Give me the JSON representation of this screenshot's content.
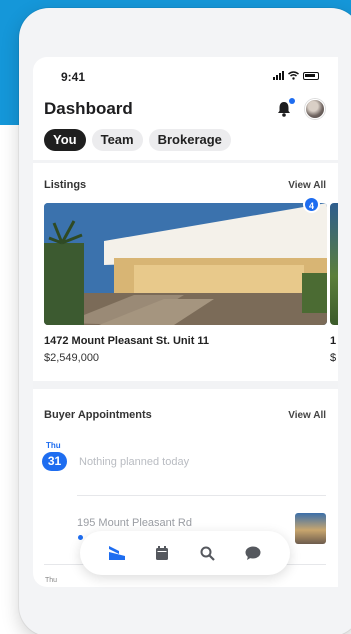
{
  "status_bar": {
    "time": "9:41"
  },
  "header": {
    "title": "Dashboard"
  },
  "tabs": [
    {
      "label": "You",
      "active": true
    },
    {
      "label": "Team",
      "active": false
    },
    {
      "label": "Brokerage",
      "active": false
    }
  ],
  "listings": {
    "title": "Listings",
    "view_all": "View All",
    "photo_badge": "4",
    "items": [
      {
        "address": "1472 Mount Pleasant St. Unit 11",
        "price": "$2,549,000"
      },
      {
        "address": "1",
        "price": "$"
      }
    ]
  },
  "appointments": {
    "title": "Buyer Appointments",
    "view_all": "View All",
    "day_label": "Thu",
    "day_number": "31",
    "empty_text": "Nothing planned today",
    "item_address": "195 Mount Pleasant Rd",
    "next_day_label": "Thu"
  },
  "colors": {
    "accent": "#1e6df0",
    "brand_bg": "#1597d9"
  },
  "nav": {
    "items": [
      {
        "icon": "home-icon",
        "active": true
      },
      {
        "icon": "calendar-icon",
        "active": false
      },
      {
        "icon": "search-icon",
        "active": false
      },
      {
        "icon": "chat-icon",
        "active": false
      }
    ]
  }
}
